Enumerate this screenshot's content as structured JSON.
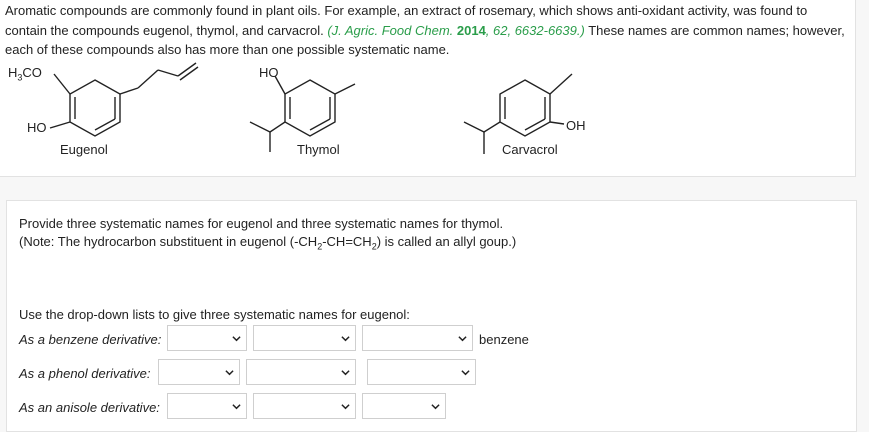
{
  "intro": {
    "part1": "Aromatic compounds are commonly found in plant oils. For example, an extract of rosemary, which shows anti-oxidant activity, was found to contain the compounds eugenol, thymol, and carvacrol. ",
    "ref_journal": "(J. Agric. Food Chem. ",
    "ref_year": "2014",
    "ref_rest": ", 62, 6632-6639.)",
    "part2": " These names are common names; however, each of these compounds also has more than one possible systematic name."
  },
  "structures": {
    "eugenol": {
      "name": "Eugenol",
      "methoxy_h": "H",
      "methoxy_sub": "3",
      "methoxy_co": "CO",
      "hydroxyl": "HO"
    },
    "thymol": {
      "name": "Thymol",
      "hydroxyl": "HO"
    },
    "carvacrol": {
      "name": "Carvacrol",
      "hydroxyl": "OH"
    }
  },
  "question": {
    "line1": "Provide three systematic names for eugenol and three systematic names for thymol.",
    "line2_pre": "(Note: The hydrocarbon substituent in eugenol (-CH",
    "sub1": "2",
    "line2_mid1": "-CH=CH",
    "sub2": "2",
    "line2_post": ") is called an allyl goup.)"
  },
  "instruction": "Use the drop-down lists to give three systematic names for eugenol:",
  "rows": [
    {
      "label": "As a benzene derivative:",
      "suffix": "benzene",
      "selects": [
        "",
        "",
        ""
      ]
    },
    {
      "label": "As a phenol derivative:",
      "suffix": "",
      "selects": [
        "",
        "",
        ""
      ]
    },
    {
      "label": "As an anisole derivative:",
      "suffix": "",
      "selects": [
        "",
        "",
        ""
      ]
    }
  ]
}
